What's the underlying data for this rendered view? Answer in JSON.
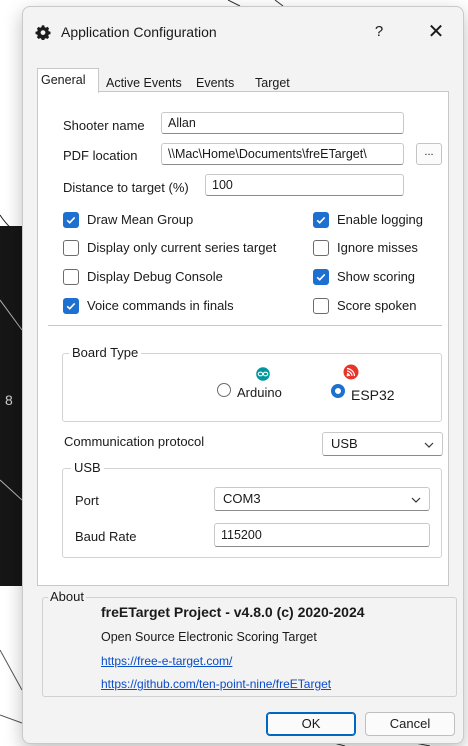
{
  "window": {
    "title": "Application Configuration",
    "help_glyph": "?",
    "close_glyph": "✕"
  },
  "background": {
    "target_label": "8"
  },
  "tabs": [
    {
      "label": "General",
      "active": true
    },
    {
      "label": "Active Events",
      "active": false
    },
    {
      "label": "Events",
      "active": false
    },
    {
      "label": "Target",
      "active": false
    }
  ],
  "general": {
    "shooter_name_label": "Shooter name",
    "shooter_name_value": "Allan",
    "pdf_location_label": "PDF location",
    "pdf_location_value": "\\\\Mac\\Home\\Documents\\freETarget\\",
    "browse_label": "...",
    "distance_label": "Distance to target (%)",
    "distance_value": "100",
    "checkboxes": [
      {
        "label": "Draw Mean Group",
        "checked": true
      },
      {
        "label": "Display only current series target",
        "checked": false
      },
      {
        "label": "Display Debug Console",
        "checked": false
      },
      {
        "label": "Voice commands in finals",
        "checked": true
      },
      {
        "label": "Enable logging",
        "checked": true
      },
      {
        "label": "Ignore misses",
        "checked": false
      },
      {
        "label": "Show scoring",
        "checked": true
      },
      {
        "label": "Score spoken",
        "checked": false
      }
    ],
    "board_type": {
      "title": "Board Type",
      "options": [
        {
          "label": "Arduino",
          "icon": "arduino-logo-icon",
          "color": "#00979d",
          "selected": false
        },
        {
          "label": "ESP32",
          "icon": "espressif-logo-icon",
          "color": "#e7352c",
          "selected": true
        }
      ]
    },
    "comm_protocol_label": "Communication protocol",
    "comm_protocol_value": "USB",
    "usb": {
      "title": "USB",
      "port_label": "Port",
      "port_value": "COM3",
      "baud_label": "Baud Rate",
      "baud_value": "115200"
    }
  },
  "about": {
    "title": "About",
    "headline": "freETarget Project  -  v4.8.0   (c) 2020-2024",
    "description": "Open Source Electronic Scoring Target",
    "link1": "https://free-e-target.com/",
    "link2": "https://github.com/ten-point-nine/freETarget"
  },
  "buttons": {
    "ok": "OK",
    "cancel": "Cancel"
  },
  "colors": {
    "accent": "#1d6fd0",
    "link": "#0b4cc7",
    "window_bg": "#f3f3f3"
  }
}
